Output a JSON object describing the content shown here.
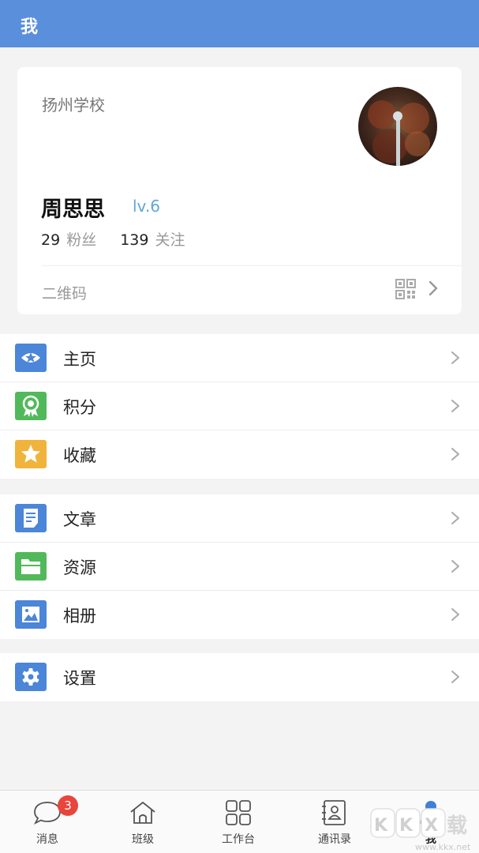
{
  "header": {
    "title": "我"
  },
  "profile": {
    "school": "扬州学校",
    "name": "周思思",
    "level": "lv.6",
    "fans_count": "29",
    "fans_label": "粉丝",
    "follow_count": "139",
    "follow_label": "关注",
    "qr_label": "二维码"
  },
  "menu_groups": [
    {
      "items": [
        {
          "label": "主页",
          "icon": "homepage-icon",
          "color": "#4b86d8"
        },
        {
          "label": "积分",
          "icon": "points-medal-icon",
          "color": "#52b95b"
        },
        {
          "label": "收藏",
          "icon": "star-icon",
          "color": "#f0b43c"
        }
      ]
    },
    {
      "items": [
        {
          "label": "文章",
          "icon": "article-icon",
          "color": "#4b86d8"
        },
        {
          "label": "资源",
          "icon": "folder-icon",
          "color": "#52b95b"
        },
        {
          "label": "相册",
          "icon": "album-icon",
          "color": "#4b86d8"
        }
      ]
    },
    {
      "items": [
        {
          "label": "设置",
          "icon": "gear-icon",
          "color": "#4b86d8"
        }
      ]
    }
  ],
  "tabbar": {
    "tabs": [
      {
        "label": "消息",
        "icon": "chat-bubble-icon",
        "badge": "3"
      },
      {
        "label": "班级",
        "icon": "house-icon"
      },
      {
        "label": "工作台",
        "icon": "grid-icon"
      },
      {
        "label": "通讯录",
        "icon": "contacts-icon"
      },
      {
        "label": "我",
        "icon": "person-icon",
        "active": true
      }
    ]
  },
  "watermark": "KKX下载 www.kkx.net",
  "colors": {
    "header": "#5a8fdc",
    "accent_blue": "#4b86d8",
    "green": "#52b95b",
    "yellow": "#f0b43c",
    "badge_red": "#e8453c",
    "level_blue": "#5fa6d9"
  }
}
